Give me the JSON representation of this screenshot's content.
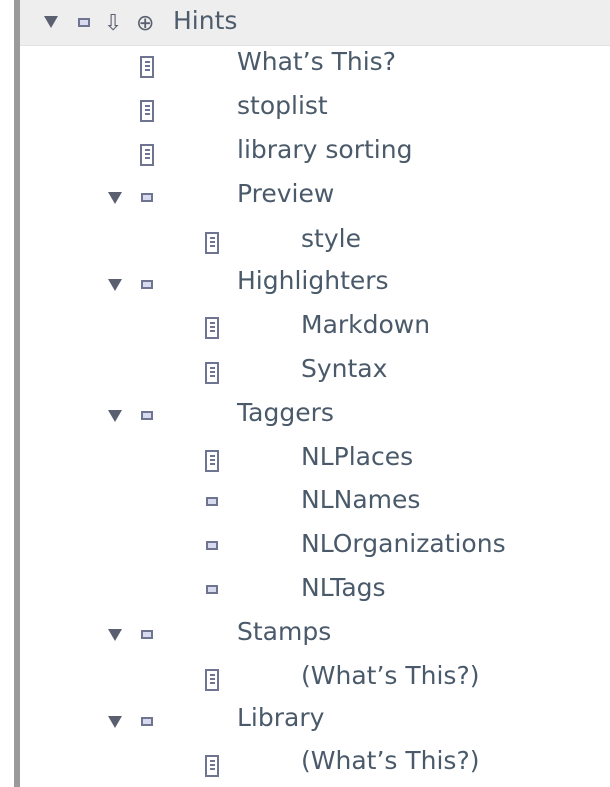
{
  "tree": {
    "root": {
      "label": "Hints",
      "icons": [
        "disclosure-triangle",
        "note-box",
        "down-arrow",
        "add-circle"
      ]
    },
    "items": [
      {
        "label": "What’s This?",
        "icon": "document-icon",
        "level": 1
      },
      {
        "label": "stoplist",
        "icon": "document-icon",
        "level": 1
      },
      {
        "label": "library sorting",
        "icon": "document-icon",
        "level": 1
      },
      {
        "label": "Preview",
        "icon": "note-box",
        "level": 1,
        "expanded": true
      },
      {
        "label": "style",
        "icon": "document-icon",
        "level": 2
      },
      {
        "label": "Highlighters",
        "icon": "note-box",
        "level": 1,
        "expanded": true
      },
      {
        "label": "Markdown",
        "icon": "document-icon",
        "level": 2
      },
      {
        "label": "Syntax",
        "icon": "document-icon",
        "level": 2
      },
      {
        "label": "Taggers",
        "icon": "note-box",
        "level": 1,
        "expanded": true
      },
      {
        "label": "NLPlaces",
        "icon": "document-icon",
        "level": 2
      },
      {
        "label": "NLNames",
        "icon": "note-box",
        "level": 2
      },
      {
        "label": "NLOrganizations",
        "icon": "note-box",
        "level": 2
      },
      {
        "label": "NLTags",
        "icon": "note-box",
        "level": 2
      },
      {
        "label": "Stamps",
        "icon": "note-box",
        "level": 1,
        "expanded": true
      },
      {
        "label": "(What’s This?)",
        "icon": "document-icon",
        "level": 2
      },
      {
        "label": "Library",
        "icon": "note-box",
        "level": 1,
        "expanded": true
      },
      {
        "label": "(What’s This?)",
        "icon": "document-icon",
        "level": 2
      }
    ]
  },
  "colors": {
    "text": "#4a5a6a",
    "icon_stroke": "#6f7590",
    "icon_fill": "#d8dbf0",
    "header_bg": "#eeeeee",
    "left_bar": "#9a9a9a"
  }
}
